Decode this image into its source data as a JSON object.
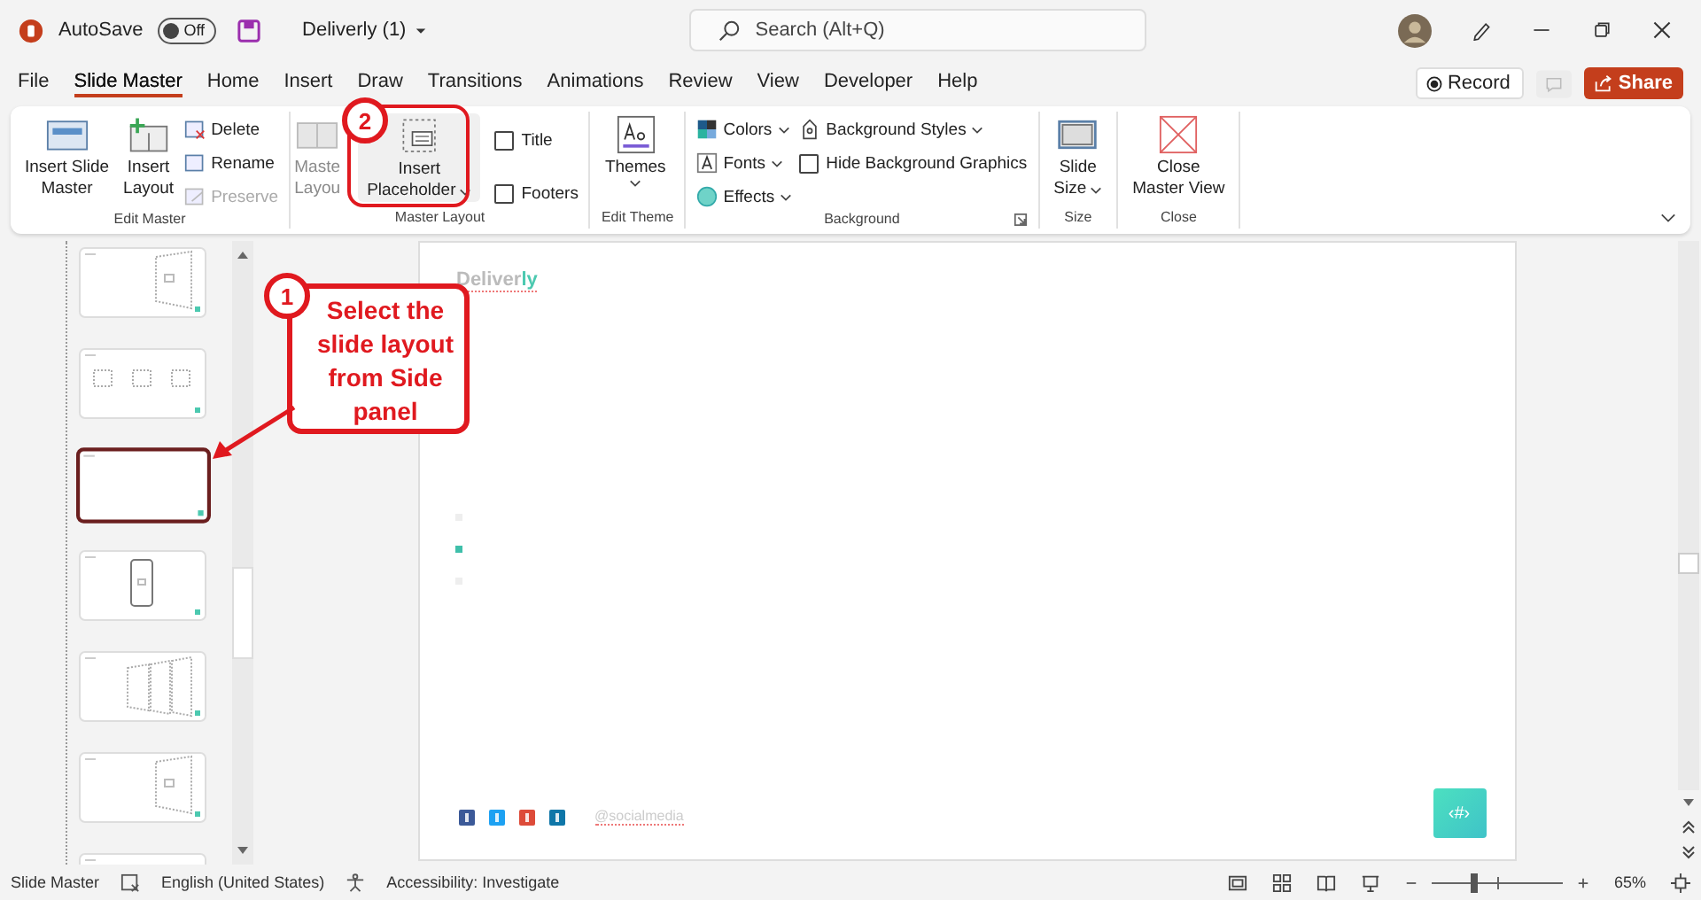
{
  "titlebar": {
    "autosave_label": "AutoSave",
    "autosave_toggle": {
      "label": "Off",
      "on": false
    },
    "document_title": "Deliverly (1)",
    "search": {
      "placeholder": "Search (Alt+Q)"
    }
  },
  "tabs": [
    {
      "label": "File",
      "selected": false
    },
    {
      "label": "Slide Master",
      "selected": true
    },
    {
      "label": "Home",
      "selected": false
    },
    {
      "label": "Insert",
      "selected": false
    },
    {
      "label": "Draw",
      "selected": false
    },
    {
      "label": "Transitions",
      "selected": false
    },
    {
      "label": "Animations",
      "selected": false
    },
    {
      "label": "Review",
      "selected": false
    },
    {
      "label": "View",
      "selected": false
    },
    {
      "label": "Developer",
      "selected": false
    },
    {
      "label": "Help",
      "selected": false
    }
  ],
  "tab_actions": {
    "record": "Record",
    "share": "Share"
  },
  "ribbon": {
    "edit_master": {
      "caption": "Edit Master",
      "big": [
        {
          "lines": [
            "Insert Slide",
            "Master"
          ]
        },
        {
          "lines": [
            "Insert",
            "Layout"
          ]
        }
      ],
      "small": [
        {
          "label": "Delete",
          "disabled": false
        },
        {
          "label": "Rename",
          "disabled": false
        },
        {
          "label": "Preserve",
          "disabled": true
        }
      ]
    },
    "master_layout": {
      "caption": "Master Layout",
      "master_button": {
        "lines": [
          "Maste",
          "Layou"
        ],
        "disabled": true
      },
      "placeholder_button": {
        "lines": [
          "Insert",
          "Placeholder"
        ]
      },
      "checkboxes": [
        {
          "label": "Title",
          "checked": false
        },
        {
          "label": "Footers",
          "checked": false
        }
      ]
    },
    "edit_theme": {
      "caption": "Edit Theme",
      "label": "Themes"
    },
    "background": {
      "caption": "Background",
      "items": [
        {
          "label": "Colors",
          "kind": "colors"
        },
        {
          "label": "Fonts",
          "kind": "fonts"
        },
        {
          "label": "Effects",
          "kind": "effects"
        }
      ],
      "styles": "Background Styles",
      "hide_graphics": {
        "label": "Hide Background Graphics",
        "checked": false
      }
    },
    "size": {
      "caption": "Size",
      "lines": [
        "Slide",
        "Size"
      ]
    },
    "close": {
      "caption": "Close",
      "lines": [
        "Close",
        "Master View"
      ]
    }
  },
  "thumbnails": [
    {
      "kind": "tilted",
      "selected": false
    },
    {
      "kind": "three",
      "selected": false
    },
    {
      "kind": "blank",
      "selected": true
    },
    {
      "kind": "phone",
      "selected": false
    },
    {
      "kind": "three-tilted",
      "selected": false
    },
    {
      "kind": "tilted",
      "selected": false
    },
    {
      "kind": "partial",
      "selected": false
    }
  ],
  "slide": {
    "brand": {
      "main": "Deliver",
      "accent": "ly"
    },
    "bullets": [
      {
        "active": false
      },
      {
        "active": true
      },
      {
        "active": false
      }
    ],
    "social_handle": "@socialmedia",
    "number_placeholder": "‹#›"
  },
  "annotations": [
    {
      "number": "2"
    },
    {
      "number": "1",
      "text": "Select the slide layout from Side panel"
    }
  ],
  "status_bar": {
    "view": "Slide Master",
    "language": "English (United States)",
    "accessibility": "Accessibility: Investigate",
    "zoom": {
      "level": 0.33,
      "reading": "65%"
    }
  }
}
